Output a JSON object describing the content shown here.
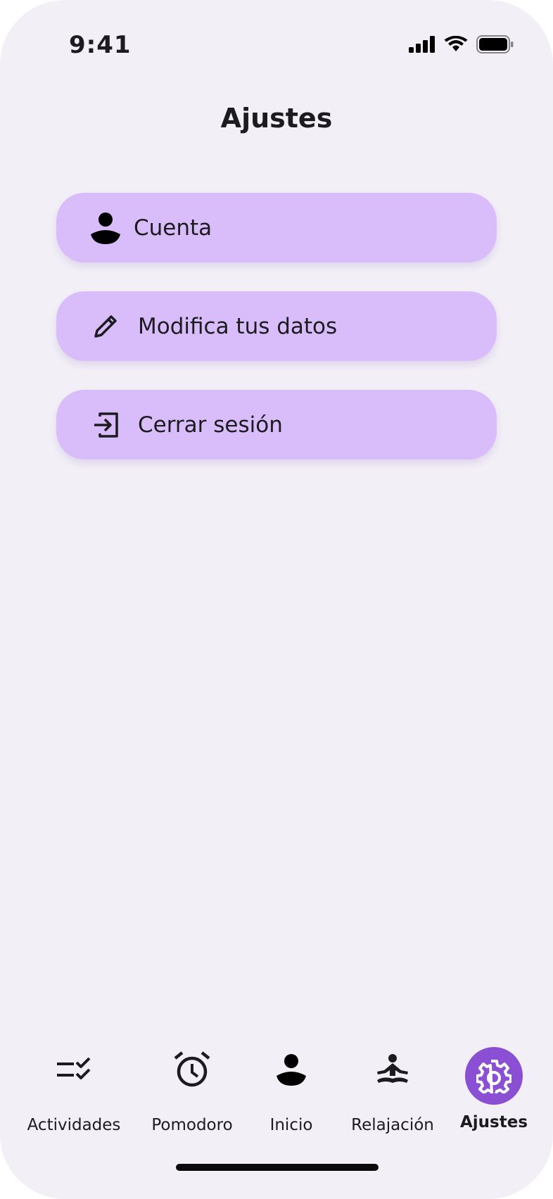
{
  "status_bar": {
    "time": "9:41",
    "icons": [
      "cellular-signal-icon",
      "wifi-icon",
      "battery-icon"
    ]
  },
  "header": {
    "title": "Ajustes"
  },
  "menu": {
    "items": [
      {
        "label": "Cuenta",
        "icon": "user-icon"
      },
      {
        "label": "Modifica tus datos",
        "icon": "pencil-icon"
      },
      {
        "label": "Cerrar sesión",
        "icon": "logout-icon"
      }
    ]
  },
  "bottom_nav": {
    "items": [
      {
        "label": "Actividades",
        "icon": "checklist-icon"
      },
      {
        "label": "Pomodoro",
        "icon": "alarm-clock-icon"
      },
      {
        "label": "Inicio",
        "icon": "user-icon"
      },
      {
        "label": "Relajación",
        "icon": "meditation-icon"
      },
      {
        "label": "Ajustes",
        "icon": "gear-icon",
        "active": true
      }
    ]
  },
  "colors": {
    "background": "#f2eff7",
    "menu_item": "#d9bdfa",
    "accent": "#8a4fd2",
    "text": "#1c1b1f"
  }
}
